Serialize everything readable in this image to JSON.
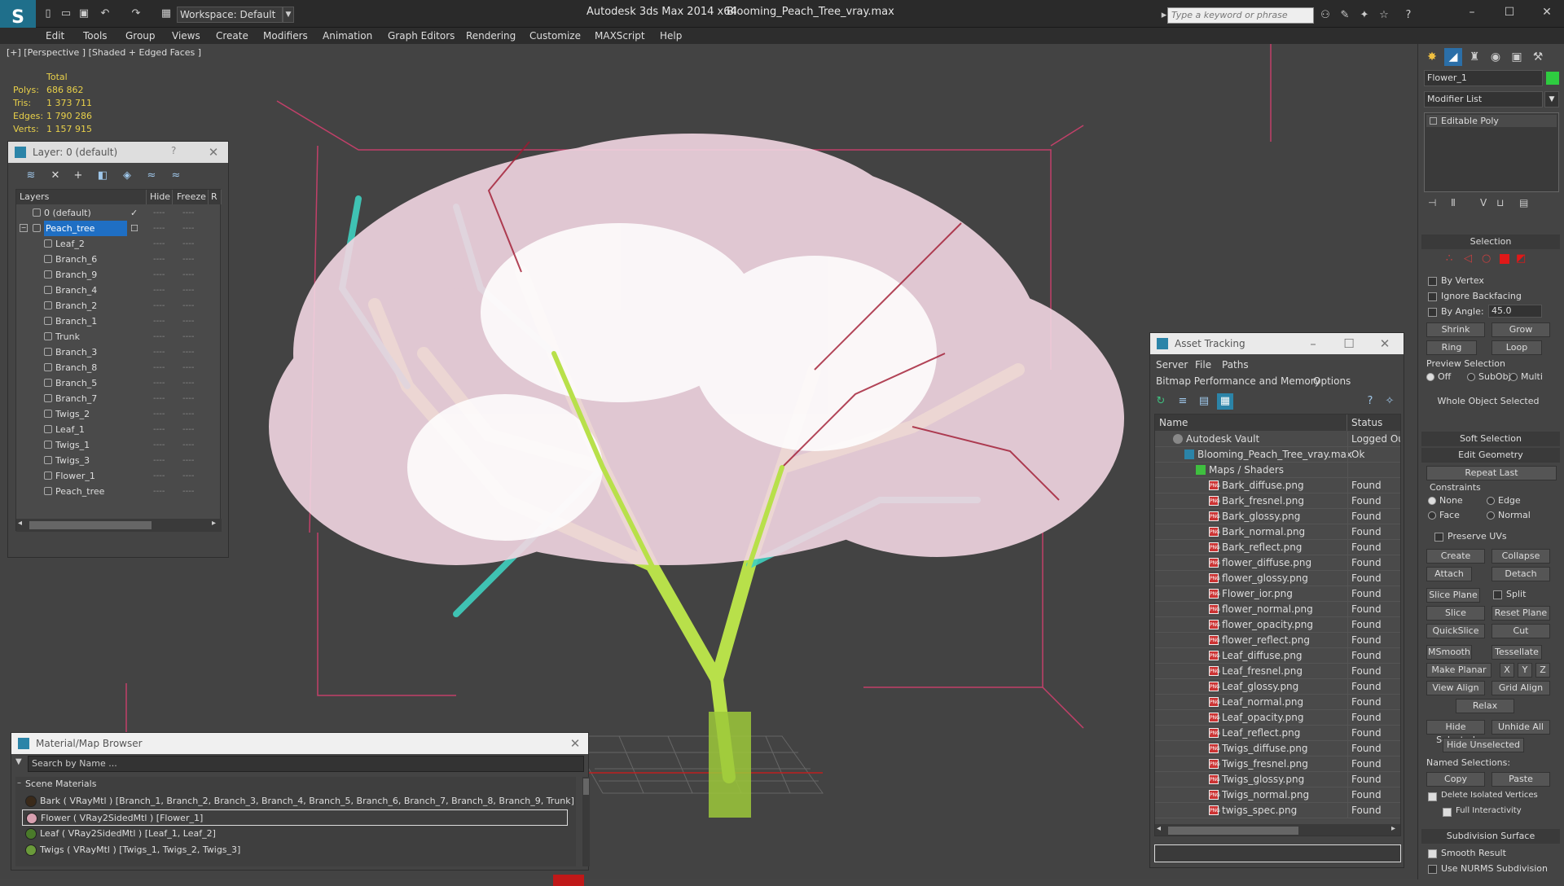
{
  "titlebar": {
    "workspace": "Workspace: Default",
    "app_title": "Autodesk 3ds Max  2014 x64",
    "file_title": "Blooming_Peach_Tree_vray.max",
    "search_placeholder": "Type a keyword or phrase"
  },
  "menubar": [
    "Edit",
    "Tools",
    "Group",
    "Views",
    "Create",
    "Modifiers",
    "Animation",
    "Graph Editors",
    "Rendering",
    "Customize",
    "MAXScript",
    "Help"
  ],
  "viewport": {
    "label": "[+] [Perspective ] [Shaded + Edged Faces ]",
    "stats": {
      "total_label": "Total",
      "rows": [
        {
          "label": "Polys:",
          "value": "686 862"
        },
        {
          "label": "Tris:",
          "value": "1 373 711"
        },
        {
          "label": "Edges:",
          "value": "1 790 286"
        },
        {
          "label": "Verts:",
          "value": "1 157 915"
        }
      ]
    }
  },
  "layer_panel": {
    "title": "Layer: 0 (default)",
    "help": "?",
    "columns": [
      "Layers",
      "Hide",
      "Freeze",
      "R"
    ],
    "rows": [
      {
        "name": "0 (default)",
        "level": 0
      },
      {
        "name": "Peach_tree",
        "level": 0
      },
      {
        "name": "Leaf_2",
        "level": 1
      },
      {
        "name": "Branch_6",
        "level": 1
      },
      {
        "name": "Branch_9",
        "level": 1
      },
      {
        "name": "Branch_4",
        "level": 1
      },
      {
        "name": "Branch_2",
        "level": 1
      },
      {
        "name": "Branch_1",
        "level": 1
      },
      {
        "name": "Trunk",
        "level": 1
      },
      {
        "name": "Branch_3",
        "level": 1
      },
      {
        "name": "Branch_8",
        "level": 1
      },
      {
        "name": "Branch_5",
        "level": 1
      },
      {
        "name": "Branch_7",
        "level": 1
      },
      {
        "name": "Twigs_2",
        "level": 1
      },
      {
        "name": "Leaf_1",
        "level": 1
      },
      {
        "name": "Twigs_1",
        "level": 1
      },
      {
        "name": "Twigs_3",
        "level": 1
      },
      {
        "name": "Flower_1",
        "level": 1
      },
      {
        "name": "Peach_tree",
        "level": 1
      }
    ],
    "dash": "----"
  },
  "asset_panel": {
    "title": "Asset Tracking",
    "menu": [
      "Server",
      "File",
      "Paths"
    ],
    "menu2": [
      "Bitmap Performance and Memory",
      "Options"
    ],
    "columns": [
      "Name",
      "Status"
    ],
    "rows": [
      {
        "name": "Autodesk Vault",
        "status": "Logged Out",
        "level": 0
      },
      {
        "name": "Blooming_Peach_Tree_vray.max",
        "status": "Ok",
        "level": 1
      },
      {
        "name": "Maps / Shaders",
        "status": "",
        "level": 2
      },
      {
        "name": "Bark_diffuse.png",
        "status": "Found",
        "level": 3
      },
      {
        "name": "Bark_fresnel.png",
        "status": "Found",
        "level": 3
      },
      {
        "name": "Bark_glossy.png",
        "status": "Found",
        "level": 3
      },
      {
        "name": "Bark_normal.png",
        "status": "Found",
        "level": 3
      },
      {
        "name": "Bark_reflect.png",
        "status": "Found",
        "level": 3
      },
      {
        "name": "flower_diffuse.png",
        "status": "Found",
        "level": 3
      },
      {
        "name": "flower_glossy.png",
        "status": "Found",
        "level": 3
      },
      {
        "name": "Flower_ior.png",
        "status": "Found",
        "level": 3
      },
      {
        "name": "flower_normal.png",
        "status": "Found",
        "level": 3
      },
      {
        "name": "flower_opacity.png",
        "status": "Found",
        "level": 3
      },
      {
        "name": "flower_reflect.png",
        "status": "Found",
        "level": 3
      },
      {
        "name": "Leaf_diffuse.png",
        "status": "Found",
        "level": 3
      },
      {
        "name": "Leaf_fresnel.png",
        "status": "Found",
        "level": 3
      },
      {
        "name": "Leaf_glossy.png",
        "status": "Found",
        "level": 3
      },
      {
        "name": "Leaf_normal.png",
        "status": "Found",
        "level": 3
      },
      {
        "name": "Leaf_opacity.png",
        "status": "Found",
        "level": 3
      },
      {
        "name": "Leaf_reflect.png",
        "status": "Found",
        "level": 3
      },
      {
        "name": "Twigs_diffuse.png",
        "status": "Found",
        "level": 3
      },
      {
        "name": "Twigs_fresnel.png",
        "status": "Found",
        "level": 3
      },
      {
        "name": "Twigs_glossy.png",
        "status": "Found",
        "level": 3
      },
      {
        "name": "Twigs_normal.png",
        "status": "Found",
        "level": 3
      },
      {
        "name": "twigs_spec.png",
        "status": "Found",
        "level": 3
      }
    ]
  },
  "material_panel": {
    "title": "Material/Map Browser",
    "search_placeholder": "Search by Name ...",
    "section": "Scene Materials",
    "rows": [
      {
        "text": "Bark  ( VRayMtl )  [Branch_1, Branch_2, Branch_3, Branch_4, Branch_5, Branch_6, Branch_7, Branch_8, Branch_9, Trunk]",
        "color": "#3a2a1a"
      },
      {
        "text": "Flower  ( VRay2SidedMtl )  [Flower_1]",
        "color": "#d8a0b0"
      },
      {
        "text": "Leaf  ( VRay2SidedMtl )  [Leaf_1, Leaf_2]",
        "color": "#4a7a2a"
      },
      {
        "text": "Twigs  ( VRayMtl )  [Twigs_1, Twigs_2, Twigs_3]",
        "color": "#6a9a3a"
      }
    ]
  },
  "command_panel": {
    "object_name": "Flower_1",
    "modifier_list": "Modifier List",
    "stack_item": "Editable Poly",
    "selection": {
      "title": "Selection",
      "by_vertex": "By Vertex",
      "ignore_backfacing": "Ignore Backfacing",
      "by_angle": "By Angle:",
      "angle_value": "45.0",
      "shrink": "Shrink",
      "grow": "Grow",
      "ring": "Ring",
      "loop": "Loop",
      "preview": "Preview Selection",
      "off": "Off",
      "subobj": "SubObj",
      "multi": "Multi",
      "status": "Whole Object Selected"
    },
    "soft_selection": "Soft Selection",
    "edit_geometry": {
      "title": "Edit Geometry",
      "repeat_last": "Repeat Last",
      "constraints": "Constraints",
      "none": "None",
      "edge": "Edge",
      "face": "Face",
      "normal": "Normal",
      "preserve_uvs": "Preserve UVs",
      "create": "Create",
      "collapse": "Collapse",
      "attach": "Attach",
      "detach": "Detach",
      "slice_plane": "Slice Plane",
      "split": "Split",
      "slice": "Slice",
      "reset_plane": "Reset Plane",
      "quickslice": "QuickSlice",
      "cut": "Cut",
      "msmooth": "MSmooth",
      "tessellate": "Tessellate",
      "make_planar": "Make Planar",
      "x": "X",
      "y": "Y",
      "z": "Z",
      "view_align": "View Align",
      "grid_align": "Grid Align",
      "relax": "Relax",
      "hide_selected": "Hide Selected",
      "unhide_all": "Unhide All",
      "hide_unselected": "Hide Unselected",
      "named_selections": "Named Selections:",
      "copy": "Copy",
      "paste": "Paste",
      "delete_isolated": "Delete Isolated Vertices",
      "full_interactivity": "Full Interactivity"
    },
    "subdivision": {
      "title": "Subdivision Surface",
      "smooth_result": "Smooth Result",
      "use_nurms": "Use NURMS Subdivision"
    }
  },
  "colors": {
    "accent": "#2b84a8",
    "selection_blue": "#1f6fc4",
    "stats_yellow": "#e8d04a",
    "object_color": "#2ecc40"
  }
}
